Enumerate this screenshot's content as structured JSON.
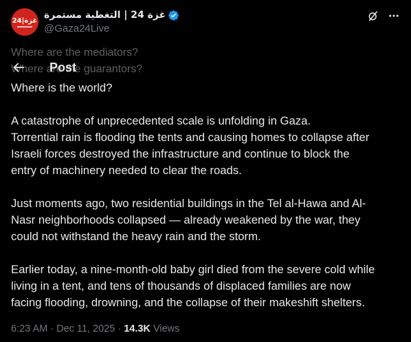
{
  "author": {
    "display_name": "غزة 24 | التغطية مستمرة",
    "handle": "@Gaza24Live",
    "avatar_text": "24|غزة",
    "verified": true
  },
  "nav": {
    "title": "Post"
  },
  "post": {
    "faded_lines": [
      "Where are the mediators?",
      "Where are the guarantors?"
    ],
    "lines": [
      "Where is the world?"
    ],
    "paragraphs": [
      [
        "A catastrophe of unprecedented scale is unfolding in Gaza.",
        "Torrential rain is flooding the tents and causing homes to collapse after",
        "Israeli forces destroyed the infrastructure and continue to block the",
        "entry of machinery needed to clear the roads."
      ],
      [
        "Just moments ago, two residential buildings in the Tel al-Hawa and Al-",
        "Nasr neighborhoods collapsed — already weakened by the war, they",
        "could not withstand the heavy rain and the storm."
      ],
      [
        "Earlier today, a nine-month-old baby girl died from the severe cold while",
        "living in a tent, and tens of thousands of displaced families are now",
        "facing flooding, drowning, and the collapse of their makeshift shelters."
      ]
    ]
  },
  "meta": {
    "time": "6:23 AM",
    "separator": "·",
    "date": "Dec 11, 2025",
    "views_count": "14.3K",
    "views_label": "Views"
  },
  "icons": {
    "verified": "verified-badge-icon",
    "grok": "grok-icon",
    "more": "more-icon",
    "back": "back-arrow-icon"
  },
  "colors": {
    "background": "#000000",
    "text": "#e7e9ea",
    "secondary": "#71767b",
    "verified": "#1d9bf0",
    "avatar": "#d0251c"
  }
}
